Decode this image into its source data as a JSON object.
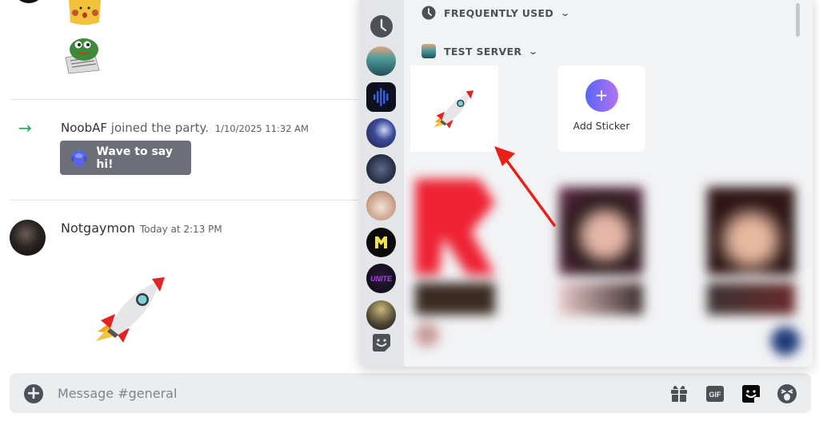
{
  "channel": {
    "name": "general",
    "messages": [
      {
        "type": "sticker-continuation",
        "stickers": [
          "surprised-pikachu-sticker",
          "pepe-newspaper-sticker"
        ]
      },
      {
        "type": "system-join",
        "username": "NoobAF",
        "text": "joined the party.",
        "timestamp": "1/10/2025 11:32 AM",
        "action_label": "Wave to say hi!"
      },
      {
        "type": "sticker",
        "username": "Notgaymon",
        "timestamp": "Today at 2:13 PM",
        "sticker": "rocket-sticker"
      }
    ]
  },
  "composer": {
    "placeholder": "Message #general",
    "value": "",
    "buttons": [
      {
        "name": "attach-button",
        "icon": "plus-circle-icon"
      },
      {
        "name": "gift-button",
        "icon": "gift-icon"
      },
      {
        "name": "gif-button",
        "icon": "gif-icon",
        "label": "GIF"
      },
      {
        "name": "sticker-button",
        "icon": "sticker-icon",
        "active": true
      },
      {
        "name": "emoji-button",
        "icon": "emoji-icon"
      }
    ]
  },
  "sticker_picker": {
    "rail": [
      {
        "name": "frequently-used",
        "icon": "clock-icon"
      },
      {
        "name": "test-server",
        "icon": "server-mountain-icon"
      },
      {
        "name": "audio-server",
        "icon": "server-waveform-icon"
      },
      {
        "name": "anime-server",
        "icon": "server-anime-icon"
      },
      {
        "name": "cod-zombies-server",
        "icon": "server-cod-icon"
      },
      {
        "name": "cat-server",
        "icon": "server-cat-icon"
      },
      {
        "name": "m-server",
        "icon": "server-m-icon"
      },
      {
        "name": "unite-server",
        "icon": "server-unite-icon"
      },
      {
        "name": "combat-server",
        "icon": "server-combat-icon"
      },
      {
        "name": "stickers-section",
        "icon": "sticker-icon"
      }
    ],
    "sections": [
      {
        "label": "FREQUENTLY USED",
        "icon": "clock-icon"
      },
      {
        "label": "TEST SERVER",
        "icon": "server-mountain-icon"
      }
    ],
    "test_server_tiles": [
      {
        "name": "rocket-sticker"
      },
      {
        "name": "add-sticker",
        "label": "Add Sticker"
      }
    ]
  },
  "annotation": {
    "color": "#e8201a",
    "points_to": "rocket-sticker"
  }
}
